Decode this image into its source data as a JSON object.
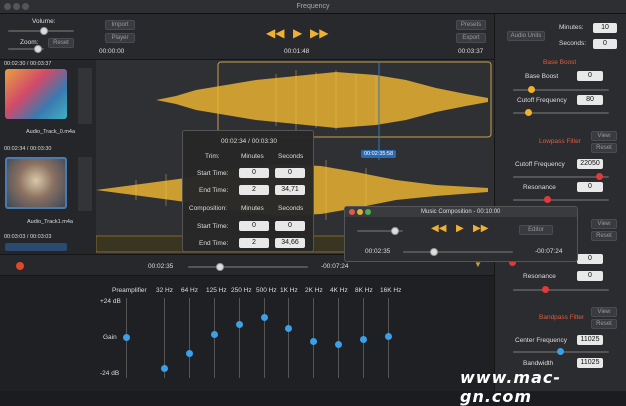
{
  "window": {
    "title": "Frequency"
  },
  "toolbar": {
    "volume_label": "Volume:",
    "zoom_label": "Zoom:",
    "reset": "Reset",
    "import": "Import",
    "player": "Player",
    "presets": "Presets",
    "export": "Export",
    "audio_units": "Audio Units",
    "time_start": "00:00:00",
    "time_mid": "00:01:48",
    "time_end": "00:03:37"
  },
  "side": {
    "minutes_label": "Minutes:",
    "minutes_value": "10",
    "seconds_label": "Seconds:",
    "seconds_value": "0"
  },
  "tracks": [
    {
      "time": "00:02:30 / 00:03:37",
      "name": "Audio_Track_0.m4a"
    },
    {
      "time": "00:02:34 / 00:03:30",
      "name": "Audio_Track1.m4a"
    },
    {
      "time": "00:03:03 / 00:03:03"
    }
  ],
  "popup": {
    "header": "00:02:34 / 00:03:30",
    "trim": "Trim:",
    "minutes": "Minutes",
    "seconds": "Seconds",
    "start_time": "Start Time:",
    "end_time": "End Time:",
    "composition": "Composition:",
    "trim_start_min": "0",
    "trim_start_sec": "0",
    "trim_end_min": "2",
    "trim_end_sec": "34,71",
    "comp_start_min": "0",
    "comp_start_sec": "0",
    "comp_end_min": "2",
    "comp_end_sec": "34,66"
  },
  "marker": "00:02:35:58",
  "transport": {
    "current": "00:02:35",
    "remaining": "-00:07:24"
  },
  "composition": {
    "title": "Music Composition - 00:10:00",
    "editor": "Editor",
    "current": "00:02:35",
    "remaining": "-00:07:24"
  },
  "eq": {
    "preamp": "Preamplifier",
    "top": "+24 dB",
    "gain": "Gain",
    "bottom": "-24 dB",
    "bands": [
      "32 Hz",
      "64 Hz",
      "125 Hz",
      "250 Hz",
      "500 Hz",
      "1K Hz",
      "2K Hz",
      "4K Hz",
      "8K Hz",
      "16K Hz"
    ]
  },
  "effects": {
    "bass": {
      "title": "Base Boost",
      "boost_label": "Base Boost",
      "boost_value": "0",
      "cutoff_label": "Cutoff Frequency",
      "cutoff_value": "80"
    },
    "lowpass": {
      "title": "Lowpass Filter",
      "view": "View",
      "reset": "Reset",
      "cutoff_label": "Cutoff Frequency",
      "cutoff_value": "22050",
      "res_label": "Resonance",
      "res_value": "0"
    },
    "highpass": {
      "view": "View",
      "reset": "Reset",
      "value1": "0",
      "res_label": "Resonance",
      "res_value": "0"
    },
    "bandpass": {
      "title": "Bandpass Filter",
      "view": "View",
      "reset": "Reset",
      "center_label": "Center Frequency",
      "center_value": "11025",
      "bw_label": "Bandwidth",
      "bw_value": "11025"
    }
  },
  "watermark": "www.mac-gn.com",
  "colors": {
    "accent_orange": "#f0b030",
    "accent_red": "#e05a3a",
    "accent_blue": "#3aa0e8",
    "wave": "#e8b030"
  }
}
